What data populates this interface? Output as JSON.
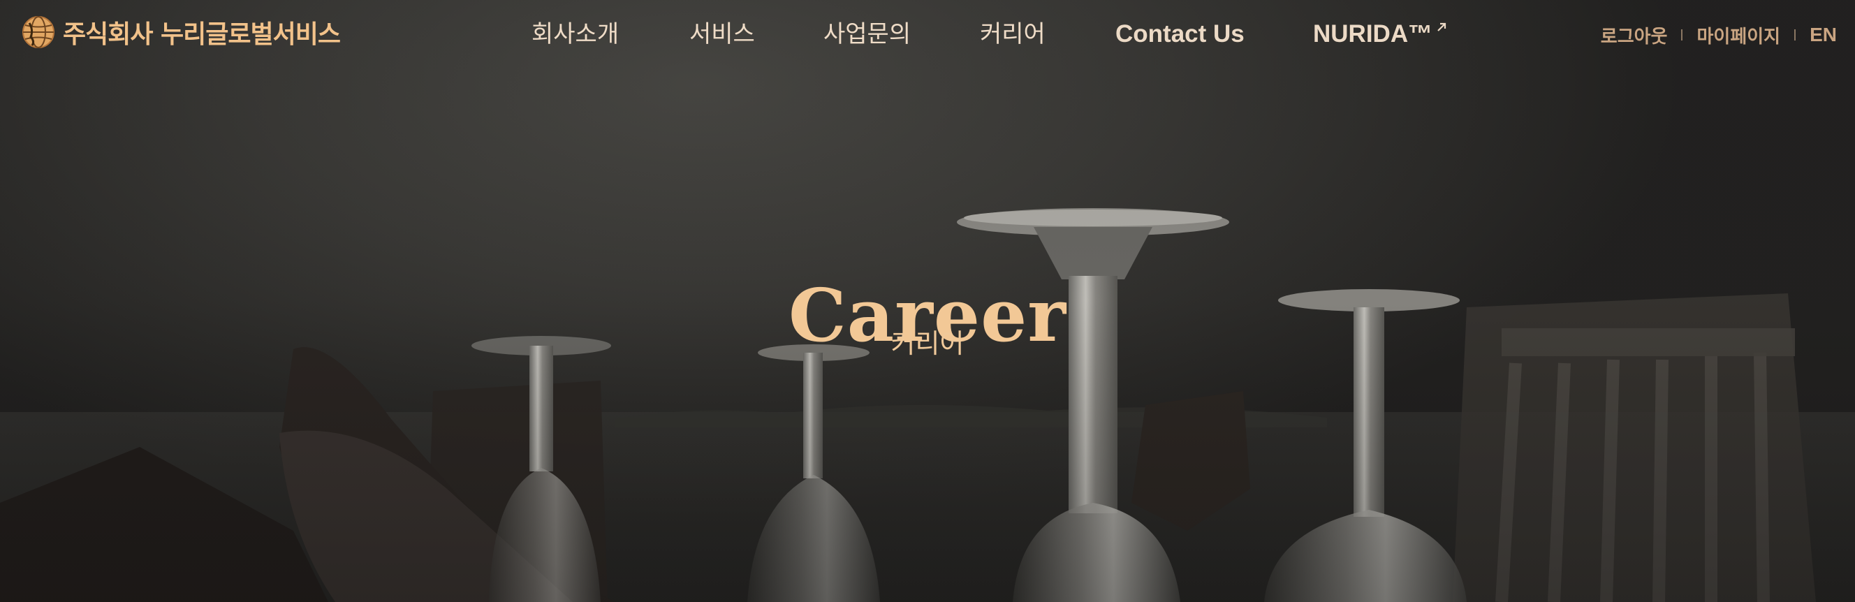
{
  "header": {
    "company_name": "주식회사 누리글로벌서비스",
    "logo_icon": "globe-icon"
  },
  "nav": {
    "items": [
      {
        "label": "회사소개"
      },
      {
        "label": "서비스"
      },
      {
        "label": "사업문의"
      },
      {
        "label": "커리어"
      },
      {
        "label": "Contact Us"
      },
      {
        "label": "NURIDA™",
        "icon": "external-link-icon"
      }
    ]
  },
  "utility": {
    "logout": "로그아웃",
    "mypage": "마이페이지",
    "language": "EN"
  },
  "hero": {
    "title": "Career",
    "subtitle": "커리어"
  },
  "colors": {
    "accent": "#f2c28a",
    "nav_text": "#efdcc7",
    "utility_text": "#caa582",
    "background": "#2a2927"
  }
}
